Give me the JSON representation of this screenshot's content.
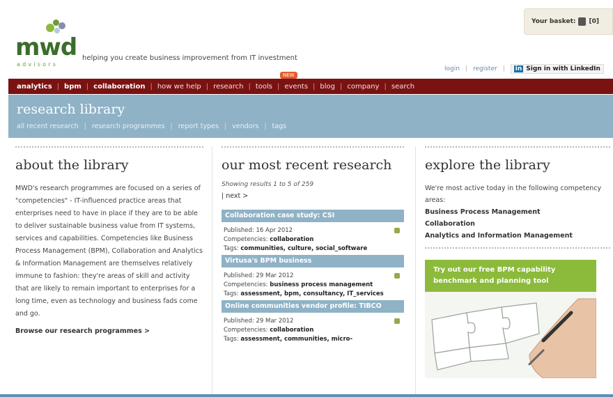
{
  "header": {
    "logo_text": "mwd",
    "logo_subtext": "advisors",
    "tagline": "helping you create business improvement from IT investment",
    "basket_label": "Your basket:",
    "basket_count": "[0]",
    "login_label": "login",
    "register_label": "register",
    "linkedin_badge": "in",
    "linkedin_label": "Sign in with LinkedIn"
  },
  "nav": {
    "new_badge": "NEW",
    "items": [
      {
        "label": "analytics",
        "bold": true
      },
      {
        "label": "bpm",
        "bold": true
      },
      {
        "label": "collaboration",
        "bold": true
      },
      {
        "label": "how we help",
        "bold": false
      },
      {
        "label": "research",
        "bold": false
      },
      {
        "label": "tools",
        "bold": false
      },
      {
        "label": "events",
        "bold": false
      },
      {
        "label": "blog",
        "bold": false
      },
      {
        "label": "company",
        "bold": false
      },
      {
        "label": "search",
        "bold": false
      }
    ]
  },
  "band": {
    "title": "research library",
    "subnav": [
      "all recent research",
      "research programmes",
      "report types",
      "vendors",
      "tags"
    ]
  },
  "about": {
    "title": "about the library",
    "body": "MWD's research programmes are focused on a series of \"competencies\" - IT-influenced practice areas that enterprises need to have in place if they are to be able to deliver sustainable business value from IT systems, services and capabilities. Competencies like Business Process Management (BPM), Collaboration and Analytics & Information Management are themselves relatively immune to fashion: they're areas of skill and activity that are likely to remain important to enterprises for a long time, even as technology and business fads come and go.",
    "browse_link": "Browse our research programmes >"
  },
  "recent": {
    "title": "our most recent research",
    "showing": "Showing results 1 to 5 of 259",
    "next": "| next >",
    "items": [
      {
        "title": "Collaboration case study: CSI",
        "published": "Published: 16 Apr 2012",
        "competencies_label": "Competencies: ",
        "competencies": "collaboration",
        "tags_label": "Tags: ",
        "tags": "communities, culture, social_software"
      },
      {
        "title": "Virtusa's BPM business",
        "published": "Published: 29 Mar 2012",
        "competencies_label": "Competencies: ",
        "competencies": "business process management",
        "tags_label": "Tags: ",
        "tags": "assessment, bpm, consultancy, IT_services"
      },
      {
        "title": "Online communities vendor profile: TIBCO",
        "published": "Published: 29 Mar 2012",
        "competencies_label": "Competencies: ",
        "competencies": "collaboration",
        "tags_label": "Tags: ",
        "tags": "assessment, communities, micro-"
      }
    ]
  },
  "explore": {
    "title": "explore the library",
    "intro": "We're most active today in the following competency areas:",
    "areas": [
      "Business Process Management",
      "Collaboration",
      "Analytics and Information Management"
    ],
    "promo_text": "Try out our free BPM capability benchmark and planning tool"
  },
  "colors": {
    "nav_bg": "#7a1212",
    "band_bg": "#8fb2c6",
    "promo_green": "#8cba3b",
    "logo_green": "#3a6e2a"
  }
}
